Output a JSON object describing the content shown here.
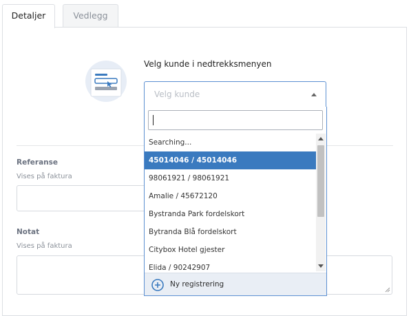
{
  "tabs": [
    {
      "label": "Detaljer",
      "active": true
    },
    {
      "label": "Vedlegg",
      "active": false
    }
  ],
  "customer": {
    "instruction": "Velg kunde i nedtrekksmenyen",
    "placeholder": "Velg kunde",
    "search_value": "",
    "options": [
      "Searching...",
      "45014046 / 45014046",
      "98061921 / 98061921",
      "Amalie / 45672120",
      "Bystranda Park fordelskort",
      "Bytranda Blå fordelskort",
      "Citybox Hotel gjester",
      "Elida / 90242907"
    ],
    "highlighted_index": 1,
    "new_registration_label": "Ny registrering"
  },
  "referanse": {
    "label": "Referanse",
    "sublabel": "Vises på faktura",
    "value": ""
  },
  "notat": {
    "label": "Notat",
    "sublabel": "Vises på faktura",
    "value": ""
  },
  "colors": {
    "accent": "#3a7abf",
    "focus_border": "#5b8fd1",
    "footer_bg": "#e9eef5"
  }
}
